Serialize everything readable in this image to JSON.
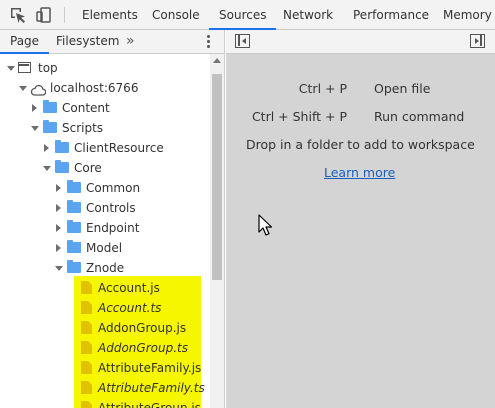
{
  "toolbar": {
    "inspect_icon": "inspect-element-icon",
    "device_icon": "device-toolbar-icon",
    "tabs": [
      {
        "label": "Elements",
        "active": false
      },
      {
        "label": "Console",
        "active": false
      },
      {
        "label": "Sources",
        "active": true
      },
      {
        "label": "Network",
        "active": false
      },
      {
        "label": "Performance",
        "active": false
      },
      {
        "label": "Memory",
        "active": false
      }
    ]
  },
  "navigator": {
    "tabs": [
      {
        "label": "Page",
        "active": true
      },
      {
        "label": "Filesystem",
        "active": false
      }
    ],
    "more_icon": "chevron-double-right-icon",
    "menu_icon": "kebab-menu-icon",
    "tree": [
      {
        "label": "top",
        "type": "frame",
        "expanded": true
      },
      {
        "label": "localhost:6766",
        "type": "domain",
        "expanded": true
      },
      {
        "label": "Content",
        "type": "folder",
        "expanded": false
      },
      {
        "label": "Scripts",
        "type": "folder",
        "expanded": true
      },
      {
        "label": "ClientResource",
        "type": "folder",
        "expanded": false
      },
      {
        "label": "Core",
        "type": "folder",
        "expanded": true
      },
      {
        "label": "Common",
        "type": "folder",
        "expanded": false
      },
      {
        "label": "Controls",
        "type": "folder",
        "expanded": false
      },
      {
        "label": "Endpoint",
        "type": "folder",
        "expanded": false
      },
      {
        "label": "Model",
        "type": "folder",
        "expanded": false
      },
      {
        "label": "Znode",
        "type": "folder",
        "expanded": true
      },
      {
        "label": "Account.js",
        "type": "file",
        "italic": false
      },
      {
        "label": "Account.ts",
        "type": "file",
        "italic": true
      },
      {
        "label": "AddonGroup.js",
        "type": "file",
        "italic": false
      },
      {
        "label": "AddonGroup.ts",
        "type": "file",
        "italic": true
      },
      {
        "label": "AttributeFamily.js",
        "type": "file",
        "italic": false
      },
      {
        "label": "AttributeFamily.ts",
        "type": "file",
        "italic": true
      },
      {
        "label": "AttributeGroup.js",
        "type": "file",
        "italic": false
      }
    ],
    "highlight_color": "#f6f600"
  },
  "editor": {
    "shortcuts": [
      {
        "keys": "Ctrl + P",
        "action": "Open file"
      },
      {
        "keys": "Ctrl + Shift + P",
        "action": "Run command"
      }
    ],
    "drop_hint": "Drop in a folder to add to workspace",
    "learn_more": "Learn more",
    "accent_color": "#1a73e8"
  }
}
